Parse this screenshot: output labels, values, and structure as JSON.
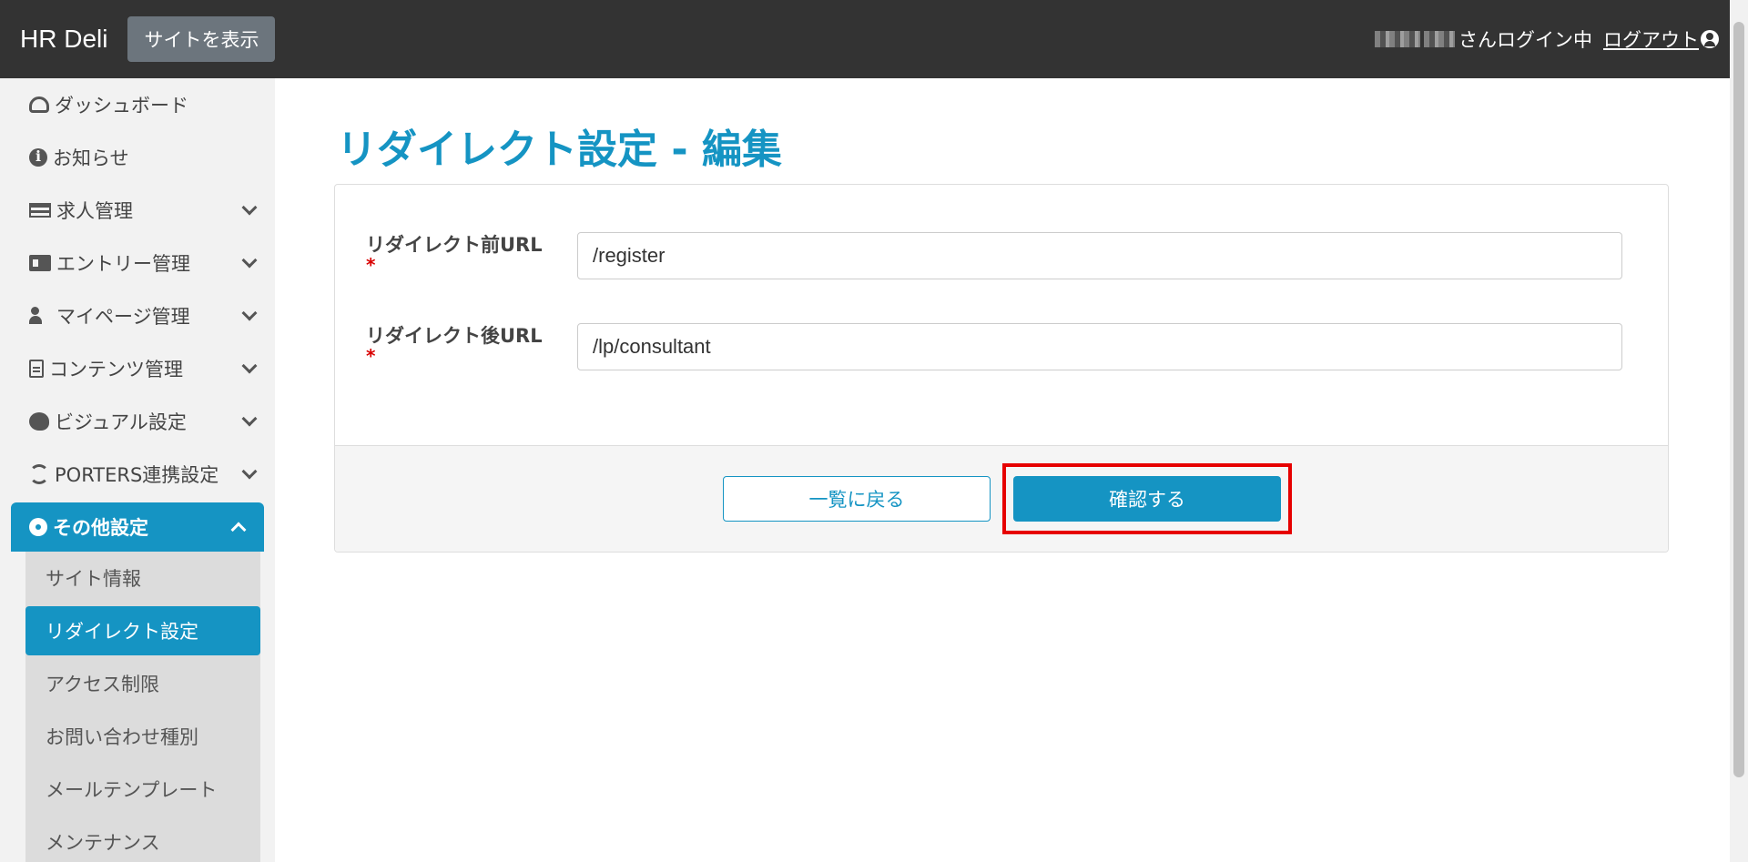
{
  "header": {
    "brand": "HR Deli",
    "view_site_label": "サイトを表示",
    "login_status": "さんログイン中",
    "logout_label": "ログアウト"
  },
  "sidebar": {
    "items": [
      {
        "label": "ダッシュボード",
        "icon": "dashboard-icon"
      },
      {
        "label": "お知らせ",
        "icon": "info-icon"
      },
      {
        "label": "求人管理",
        "icon": "list-icon"
      },
      {
        "label": "エントリー管理",
        "icon": "id-card-icon"
      },
      {
        "label": "マイページ管理",
        "icon": "user-cog-icon"
      },
      {
        "label": "コンテンツ管理",
        "icon": "file-icon"
      },
      {
        "label": "ビジュアル設定",
        "icon": "palette-icon"
      },
      {
        "label": "PORTERS連携設定",
        "icon": "sync-icon"
      },
      {
        "label": "その他設定",
        "icon": "gear-icon"
      }
    ],
    "submenu": [
      {
        "label": "サイト情報"
      },
      {
        "label": "リダイレクト設定"
      },
      {
        "label": "アクセス制限"
      },
      {
        "label": "お問い合わせ種別"
      },
      {
        "label": "メールテンプレート"
      },
      {
        "label": "メンテナンス"
      }
    ]
  },
  "main": {
    "title": "リダイレクト設定 - 編集",
    "fields": [
      {
        "label": "リダイレクト前URL",
        "required": "*",
        "value": "/register"
      },
      {
        "label": "リダイレクト後URL",
        "required": "*",
        "value": "/lp/consultant"
      }
    ],
    "back_label": "一覧に戻る",
    "confirm_label": "確認する"
  },
  "colors": {
    "accent": "#1594c3",
    "header_bg": "#333333",
    "highlight": "#e60000"
  }
}
